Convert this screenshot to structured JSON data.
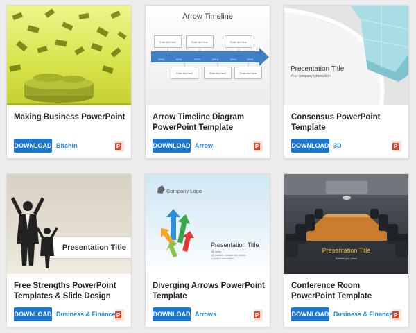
{
  "cards": [
    {
      "title": "Making Business PowerPoint",
      "download_label": "DOWNLOAD",
      "tag": "Bitchin",
      "thumb": {
        "icon": "money-rain-icon"
      }
    },
    {
      "title": "Arrow Timeline Diagram PowerPoint Template",
      "download_label": "DOWNLOAD",
      "tag": "Arrow",
      "thumb": {
        "heading": "Arrow Timeline",
        "box_text": "Enter text here",
        "years": [
          "2010",
          "2011",
          "2012",
          "2013",
          "2014",
          "2015"
        ]
      }
    },
    {
      "title": "Consensus PowerPoint Template",
      "download_label": "DOWNLOAD",
      "tag": "3D",
      "thumb": {
        "heading": "Presentation Title",
        "subheading": "Your company information"
      }
    },
    {
      "title": "Free Strengths PowerPoint Templates & Slide Design",
      "download_label": "DOWNLOAD",
      "tag": "Business & Finance",
      "thumb": {
        "heading": "Presentation Title"
      }
    },
    {
      "title": "Diverging Arrows PowerPoint Template",
      "download_label": "DOWNLOAD",
      "tag": "Arrows",
      "thumb": {
        "logo_text": "Company Logo",
        "heading": "Presentation Title",
        "subheading": "My name\nMy position, contact information\nor project description"
      }
    },
    {
      "title": "Conference Room PowerPoint Template",
      "download_label": "DOWNLOAD",
      "tag": "Business & Finance",
      "thumb": {
        "heading": "Presentation Title",
        "subheading": "Subtitle you place"
      }
    }
  ],
  "colors": {
    "accent": "#1976d2",
    "tag": "#1e88e5",
    "ppt_icon": "#d9472b"
  }
}
